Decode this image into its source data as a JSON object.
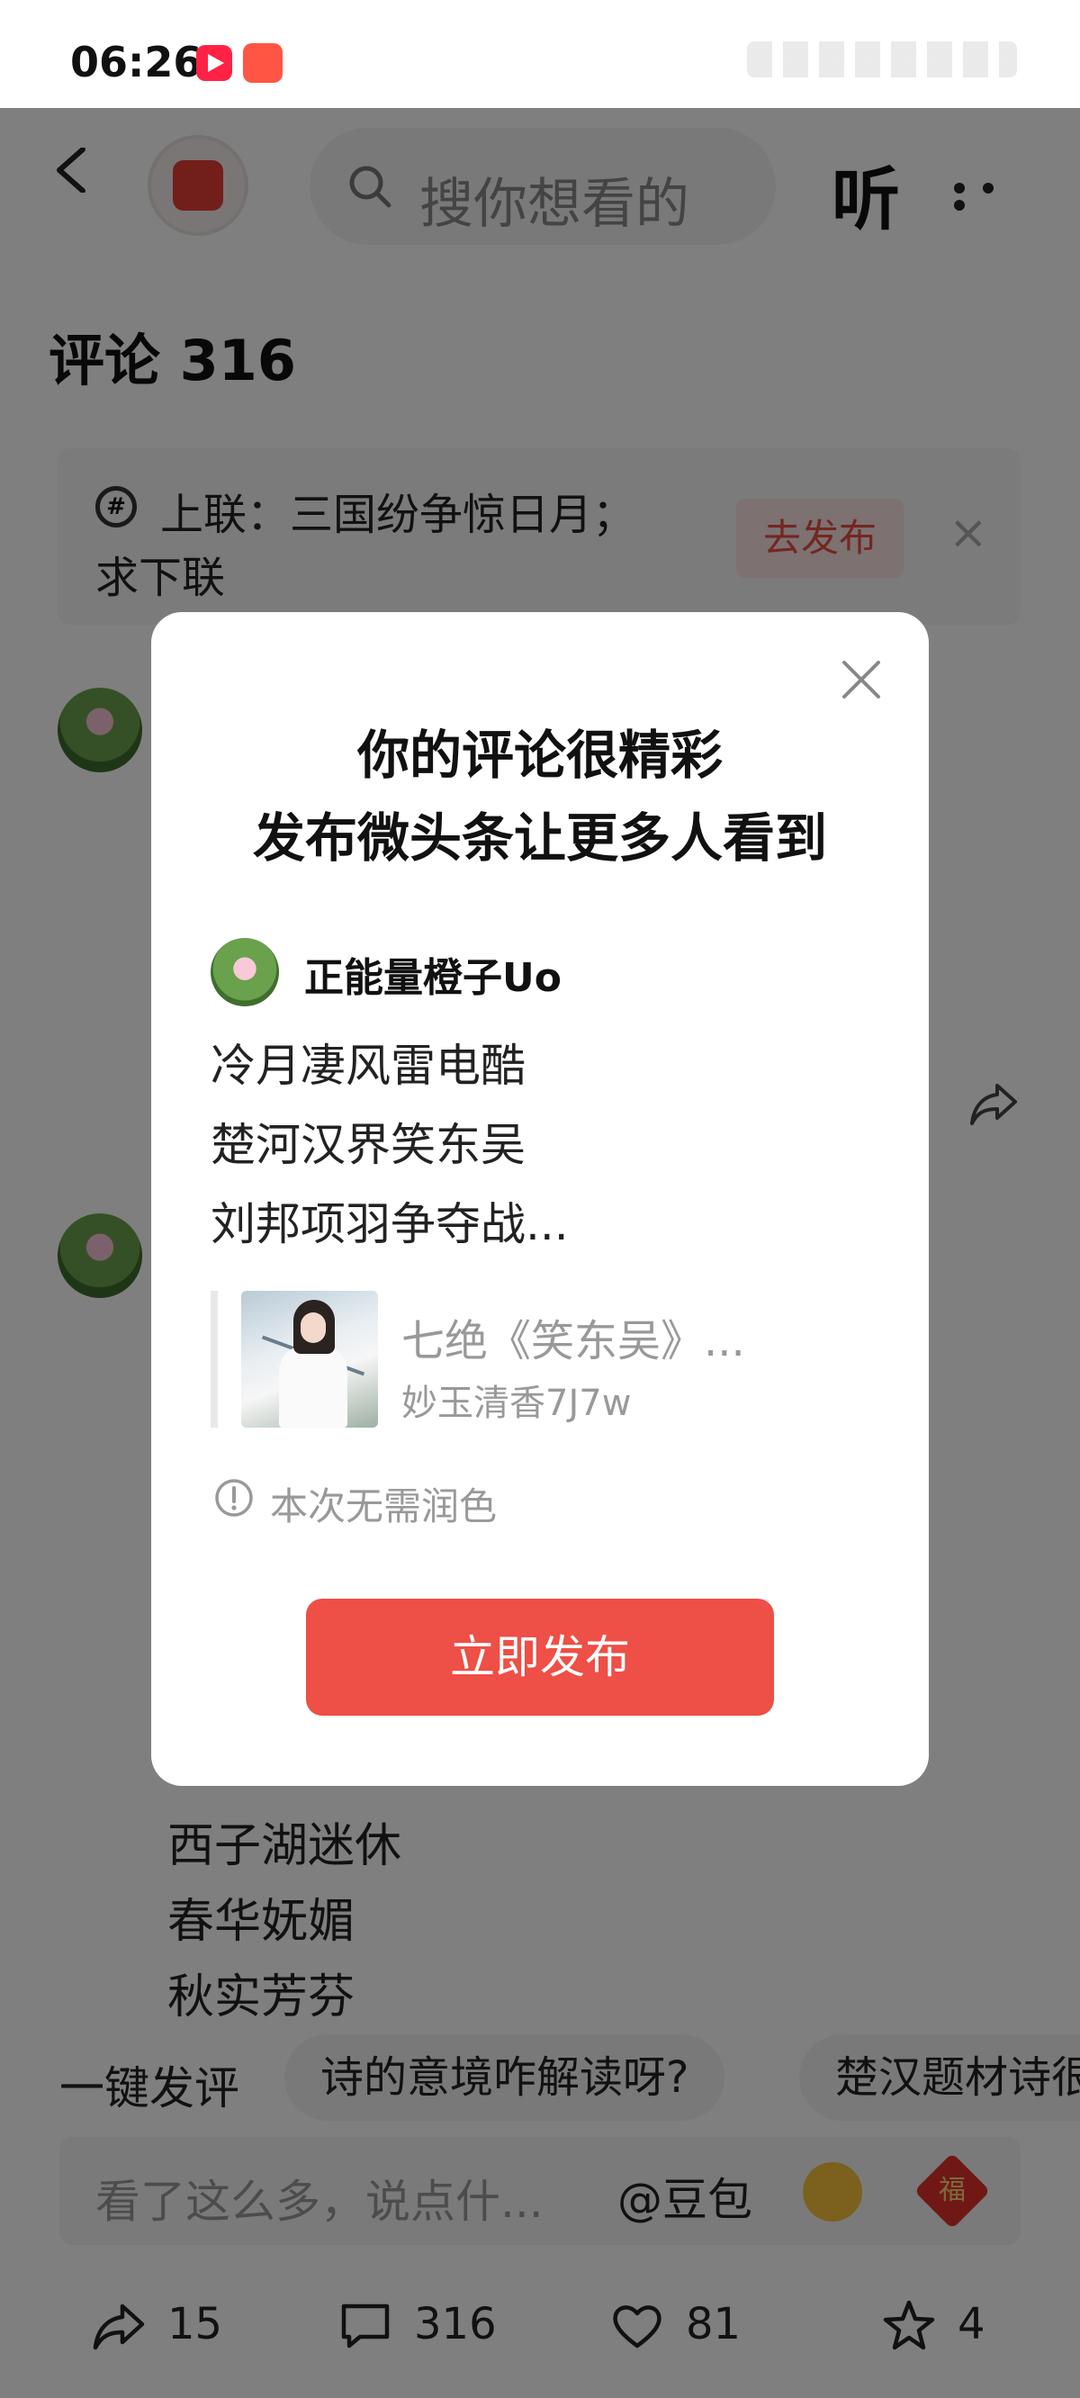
{
  "status": {
    "time": "06:26"
  },
  "nav": {
    "search_placeholder": "搜你想看的",
    "listen_label": "听"
  },
  "comments": {
    "title": "评论 316"
  },
  "topic": {
    "line1": "上联：三国纷争惊日月；",
    "line2": "求下联",
    "publish_label": "去发布"
  },
  "background_comment": {
    "lines": [
      "西子湖迷休",
      "春华妩媚",
      "秋实芳芬"
    ]
  },
  "chips": {
    "label": "一键发评",
    "items": [
      "诗的意境咋解读呀?",
      "楚汉题材诗很"
    ]
  },
  "input": {
    "placeholder": "看了这么多，说点什...",
    "doubao_label": "@豆包",
    "fu_char": "福"
  },
  "actions": {
    "share_count": "15",
    "comment_count": "316",
    "like_count": "81",
    "favorite_count": "4"
  },
  "modal": {
    "title_line1": "你的评论很精彩",
    "title_line2": "发布微头条让更多人看到",
    "username": "正能量橙子Uo",
    "comment_lines": [
      "冷月凄风雷电酷",
      "楚河汉界笑东吴",
      "刘邦项羽争夺战..."
    ],
    "quote_title": "七绝《笑东吴》...",
    "quote_author": "妙玉清香7J7w",
    "hint": "本次无需润色",
    "publish_button": "立即发布"
  },
  "colors": {
    "accent": "#ee4f46",
    "overlay": "rgba(0,0,0,0.5)"
  }
}
